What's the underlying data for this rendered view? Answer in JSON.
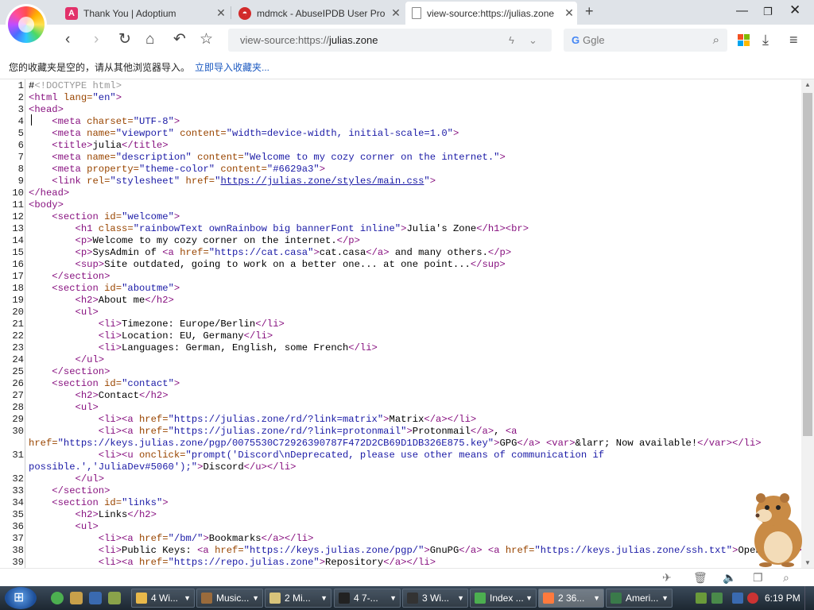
{
  "tabs": [
    {
      "title": "Thank You | Adoptium",
      "icon": "adoptium-icon",
      "color": "#e2316a"
    },
    {
      "title": "mdmck - AbuseIPDB User Pro",
      "icon": "abuseipdb-icon",
      "color": "#d22a2a"
    },
    {
      "title": "view-source:https://julias.zone",
      "icon": "page-icon",
      "color": "#888888"
    }
  ],
  "address": {
    "prefix": "view-source:https://",
    "domain": "julias.zone"
  },
  "search": {
    "engine": "G",
    "placeholder": "Ggle"
  },
  "bookmarks_bar": {
    "message": "您的收藏夹是空的，请从其他浏览器导入。",
    "link": "立即导入收藏夹..."
  },
  "source_lines": [
    {
      "n": "1",
      "html": "#<span class=\"c\">&lt;!DOCTYPE html&gt;</span>"
    },
    {
      "n": "2",
      "html": "<span class=\"t\">&lt;html</span> <span class=\"a\">lang=</span><span class=\"v\">\"en\"</span><span class=\"t\">&gt;</span>"
    },
    {
      "n": "3",
      "html": "<span class=\"t\">&lt;head&gt;</span>"
    },
    {
      "n": "4",
      "html": "    <span class=\"t\">&lt;meta</span> <span class=\"a\">charset=</span><span class=\"v\">\"UTF-8\"</span><span class=\"t\">&gt;</span>"
    },
    {
      "n": "5",
      "html": "    <span class=\"t\">&lt;meta</span> <span class=\"a\">name=</span><span class=\"v\">\"viewport\"</span> <span class=\"a\">content=</span><span class=\"v\">\"width=device-width, initial-scale=1.0\"</span><span class=\"t\">&gt;</span>"
    },
    {
      "n": "6",
      "html": "    <span class=\"t\">&lt;title&gt;</span>julia<span class=\"t\">&lt;/title&gt;</span>"
    },
    {
      "n": "7",
      "html": "    <span class=\"t\">&lt;meta</span> <span class=\"a\">name=</span><span class=\"v\">\"description\"</span> <span class=\"a\">content=</span><span class=\"v\">\"Welcome to my cozy corner on the internet.\"</span><span class=\"t\">&gt;</span>"
    },
    {
      "n": "8",
      "html": "    <span class=\"t\">&lt;meta</span> <span class=\"a\">property=</span><span class=\"v\">\"theme-color\"</span> <span class=\"a\">content=</span><span class=\"v\">\"#6629a3\"</span><span class=\"t\">&gt;</span>"
    },
    {
      "n": "9",
      "html": "    <span class=\"t\">&lt;link</span> <span class=\"a\">rel=</span><span class=\"v\">\"stylesheet\"</span> <span class=\"a\">href=</span><span class=\"v\">\"</span><span class=\"u\">https://julias.zone/styles/main.css</span><span class=\"v\">\"</span><span class=\"t\">&gt;</span>"
    },
    {
      "n": "10",
      "html": "<span class=\"t\">&lt;/head&gt;</span>"
    },
    {
      "n": "11",
      "html": "<span class=\"t\">&lt;body&gt;</span>"
    },
    {
      "n": "12",
      "html": "    <span class=\"t\">&lt;section</span> <span class=\"a\">id=</span><span class=\"v\">\"welcome\"</span><span class=\"t\">&gt;</span>"
    },
    {
      "n": "13",
      "html": "        <span class=\"t\">&lt;h1</span> <span class=\"a\">class=</span><span class=\"v\">\"rainbowText ownRainbow big bannerFont inline\"</span><span class=\"t\">&gt;</span>Julia's Zone<span class=\"t\">&lt;/h1&gt;&lt;br&gt;</span>"
    },
    {
      "n": "14",
      "html": "        <span class=\"t\">&lt;p&gt;</span>Welcome to my cozy corner on the internet.<span class=\"t\">&lt;/p&gt;</span>"
    },
    {
      "n": "15",
      "html": "        <span class=\"t\">&lt;p&gt;</span>SysAdmin of <span class=\"t\">&lt;a</span> <span class=\"a\">href=</span><span class=\"v\">\"https://cat.casa\"</span><span class=\"t\">&gt;</span>cat.casa<span class=\"t\">&lt;/a&gt;</span> and many others.<span class=\"t\">&lt;/p&gt;</span>"
    },
    {
      "n": "16",
      "html": "        <span class=\"t\">&lt;sup&gt;</span>Site outdated, going to work on a better one... at one point...<span class=\"t\">&lt;/sup&gt;</span>"
    },
    {
      "n": "17",
      "html": "    <span class=\"t\">&lt;/section&gt;</span>"
    },
    {
      "n": "18",
      "html": "    <span class=\"t\">&lt;section</span> <span class=\"a\">id=</span><span class=\"v\">\"aboutme\"</span><span class=\"t\">&gt;</span>"
    },
    {
      "n": "19",
      "html": "        <span class=\"t\">&lt;h2&gt;</span>About me<span class=\"t\">&lt;/h2&gt;</span>"
    },
    {
      "n": "20",
      "html": "        <span class=\"t\">&lt;ul&gt;</span>"
    },
    {
      "n": "21",
      "html": "            <span class=\"t\">&lt;li&gt;</span>Timezone: Europe/Berlin<span class=\"t\">&lt;/li&gt;</span>"
    },
    {
      "n": "22",
      "html": "            <span class=\"t\">&lt;li&gt;</span>Location: EU, Germany<span class=\"t\">&lt;/li&gt;</span>"
    },
    {
      "n": "23",
      "html": "            <span class=\"t\">&lt;li&gt;</span>Languages: German, English, some French<span class=\"t\">&lt;/li&gt;</span>"
    },
    {
      "n": "24",
      "html": "        <span class=\"t\">&lt;/ul&gt;</span>"
    },
    {
      "n": "25",
      "html": "    <span class=\"t\">&lt;/section&gt;</span>"
    },
    {
      "n": "26",
      "html": "    <span class=\"t\">&lt;section</span> <span class=\"a\">id=</span><span class=\"v\">\"contact\"</span><span class=\"t\">&gt;</span>"
    },
    {
      "n": "27",
      "html": "        <span class=\"t\">&lt;h2&gt;</span>Contact<span class=\"t\">&lt;/h2&gt;</span>"
    },
    {
      "n": "28",
      "html": "        <span class=\"t\">&lt;ul&gt;</span>"
    },
    {
      "n": "29",
      "html": "            <span class=\"t\">&lt;li&gt;&lt;a</span> <span class=\"a\">href=</span><span class=\"v\">\"https://julias.zone/rd/?link=matrix\"</span><span class=\"t\">&gt;</span>Matrix<span class=\"t\">&lt;/a&gt;&lt;/li&gt;</span>"
    },
    {
      "n": "30",
      "html": "            <span class=\"t\">&lt;li&gt;&lt;a</span> <span class=\"a\">href=</span><span class=\"v\">\"https://julias.zone/rd/?link=protonmail\"</span><span class=\"t\">&gt;</span>Protonmail<span class=\"t\">&lt;/a&gt;</span>, <span class=\"t\">&lt;a</span>"
    },
    {
      "n": "",
      "html": "<span class=\"a\">href=</span><span class=\"v\">\"https://keys.julias.zone/pgp/0075530C72926390787F472D2CB69D1DB326E875.key\"</span><span class=\"t\">&gt;</span>GPG<span class=\"t\">&lt;/a&gt;</span> <span class=\"t\">&lt;var&gt;</span>&amp;larr; Now available!<span class=\"t\">&lt;/var&gt;&lt;/li&gt;</span>"
    },
    {
      "n": "31",
      "html": "            <span class=\"t\">&lt;li&gt;&lt;u</span> <span class=\"a\">onclick=</span><span class=\"v\">\"prompt('Discord\\nDeprecated, please use other means of communication if</span>"
    },
    {
      "n": "",
      "html": "<span class=\"v\">possible.','JuliaDev#5060');\"</span><span class=\"t\">&gt;</span>Discord<span class=\"t\">&lt;/u&gt;&lt;/li&gt;</span>"
    },
    {
      "n": "32",
      "html": "        <span class=\"t\">&lt;/ul&gt;</span>"
    },
    {
      "n": "33",
      "html": "    <span class=\"t\">&lt;/section&gt;</span>"
    },
    {
      "n": "34",
      "html": "    <span class=\"t\">&lt;section</span> <span class=\"a\">id=</span><span class=\"v\">\"links\"</span><span class=\"t\">&gt;</span>"
    },
    {
      "n": "35",
      "html": "        <span class=\"t\">&lt;h2&gt;</span>Links<span class=\"t\">&lt;/h2&gt;</span>"
    },
    {
      "n": "36",
      "html": "        <span class=\"t\">&lt;ul&gt;</span>"
    },
    {
      "n": "37",
      "html": "            <span class=\"t\">&lt;li&gt;&lt;a</span> <span class=\"a\">href=</span><span class=\"v\">\"/bm/\"</span><span class=\"t\">&gt;</span>Bookmarks<span class=\"t\">&lt;/a&gt;&lt;/li&gt;</span>"
    },
    {
      "n": "38",
      "html": "            <span class=\"t\">&lt;li&gt;</span>Public Keys: <span class=\"t\">&lt;a</span> <span class=\"a\">href=</span><span class=\"v\">\"https://keys.julias.zone/pgp/\"</span><span class=\"t\">&gt;</span>GnuPG<span class=\"t\">&lt;/a&gt;</span> <span class=\"t\">&lt;a</span> <span class=\"a\">href=</span><span class=\"v\">\"https://keys.julias.zone/ssh.txt\"</span><span class=\"t\">&gt;</span>OpenSSH<span class=\"t\">&lt;/a&gt;</span>"
    },
    {
      "n": "39",
      "html": "            <span class=\"t\">&lt;li&gt;&lt;a</span> <span class=\"a\">href=</span><span class=\"v\">\"https://repo.julias.zone\"</span><span class=\"t\">&gt;</span>Repository<span class=\"t\">&lt;/a&gt;&lt;/li&gt;</span>"
    }
  ],
  "taskbar": {
    "buttons": [
      {
        "label": "4 Wi...",
        "icon": "folder-icon",
        "color": "#e8b84a"
      },
      {
        "label": "Music...",
        "icon": "music-icon",
        "color": "#9a6b3c"
      },
      {
        "label": "2 Mi...",
        "icon": "document-icon",
        "color": "#d8c37a"
      },
      {
        "label": "4 7-...",
        "icon": "7zip-icon",
        "color": "#222222"
      },
      {
        "label": "3 Wi...",
        "icon": "console-icon",
        "color": "#333333"
      },
      {
        "label": "Index ...",
        "icon": "chrome-icon",
        "color": "#4caf50"
      },
      {
        "label": "2 36...",
        "icon": "browser-icon",
        "color": "#ff7a3d"
      },
      {
        "label": "Ameri...",
        "icon": "vlc-icon",
        "color": "#3a7a4a"
      }
    ],
    "clock": "6:19 PM"
  }
}
